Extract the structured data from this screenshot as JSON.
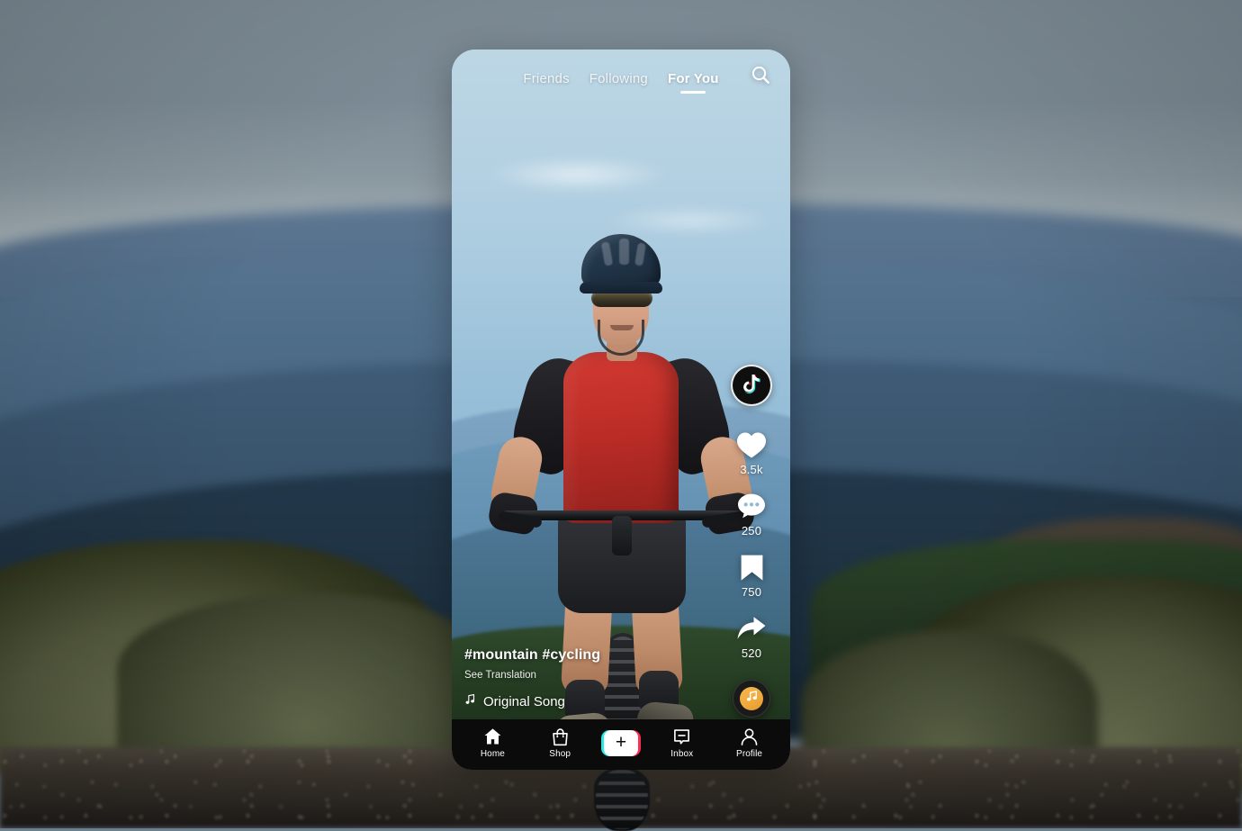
{
  "background": {
    "description": "Blurred mountain landscape with sagebrush and gravel road",
    "sky_color": "#7d8c96",
    "ridge_color": "#4b6a86",
    "brush_color": "#555b3f",
    "road_color": "#3c362e"
  },
  "phone": {
    "video_subject": "Mountain biker riding toward camera on a dirt road",
    "sky_color": "#b4d1e2",
    "jersey_color": "#bb2c26",
    "helmet_color": "#22364a"
  },
  "topnav": {
    "tabs": [
      {
        "label": "Friends",
        "active": false
      },
      {
        "label": "Following",
        "active": false
      },
      {
        "label": "For You",
        "active": true
      }
    ],
    "search_icon": "search-icon"
  },
  "rail": {
    "avatar_icon": "tiktok-logo-icon",
    "actions": [
      {
        "icon": "heart-icon",
        "name": "like",
        "count": "3.5k"
      },
      {
        "icon": "comment-icon",
        "name": "comment",
        "count": "250"
      },
      {
        "icon": "bookmark-icon",
        "name": "bookmark",
        "count": "750"
      },
      {
        "icon": "share-icon",
        "name": "share",
        "count": "520"
      }
    ],
    "music_disc_icon": "music-note-icon",
    "disc_accent_color": "#f0a93c"
  },
  "caption": {
    "hashtags": "#mountain #cycling",
    "translate_label": "See Translation",
    "song_icon": "music-note-icon",
    "song_label": "Original Song"
  },
  "bottomnav": {
    "items": [
      {
        "label": "Home",
        "icon": "home-icon"
      },
      {
        "label": "Shop",
        "icon": "shopping-bag-icon"
      },
      {
        "label": "Inbox",
        "icon": "inbox-message-icon"
      },
      {
        "label": "Profile",
        "icon": "person-icon"
      }
    ],
    "create_button": {
      "symbol": "+",
      "left_color": "#27e8e3",
      "right_color": "#fe2c55"
    }
  }
}
